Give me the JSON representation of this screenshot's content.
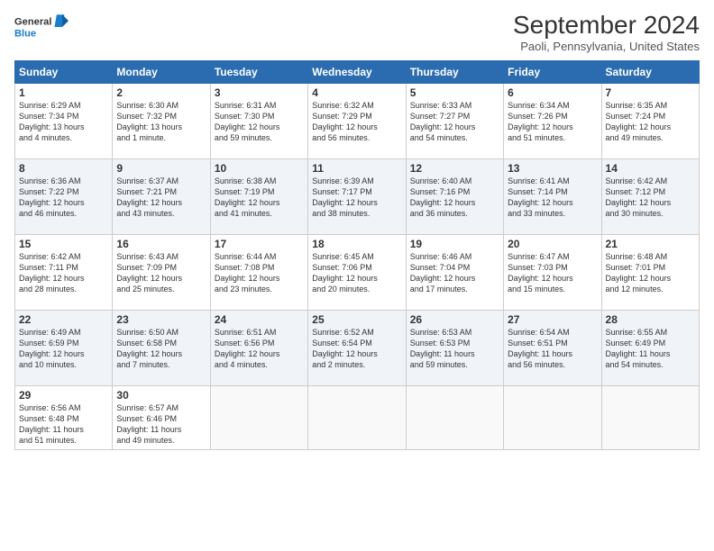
{
  "logo": {
    "line1": "General",
    "line2": "Blue"
  },
  "title": "September 2024",
  "location": "Paoli, Pennsylvania, United States",
  "days_header": [
    "Sunday",
    "Monday",
    "Tuesday",
    "Wednesday",
    "Thursday",
    "Friday",
    "Saturday"
  ],
  "weeks": [
    [
      {
        "num": "1",
        "lines": [
          "Sunrise: 6:29 AM",
          "Sunset: 7:34 PM",
          "Daylight: 13 hours",
          "and 4 minutes."
        ]
      },
      {
        "num": "2",
        "lines": [
          "Sunrise: 6:30 AM",
          "Sunset: 7:32 PM",
          "Daylight: 13 hours",
          "and 1 minute."
        ]
      },
      {
        "num": "3",
        "lines": [
          "Sunrise: 6:31 AM",
          "Sunset: 7:30 PM",
          "Daylight: 12 hours",
          "and 59 minutes."
        ]
      },
      {
        "num": "4",
        "lines": [
          "Sunrise: 6:32 AM",
          "Sunset: 7:29 PM",
          "Daylight: 12 hours",
          "and 56 minutes."
        ]
      },
      {
        "num": "5",
        "lines": [
          "Sunrise: 6:33 AM",
          "Sunset: 7:27 PM",
          "Daylight: 12 hours",
          "and 54 minutes."
        ]
      },
      {
        "num": "6",
        "lines": [
          "Sunrise: 6:34 AM",
          "Sunset: 7:26 PM",
          "Daylight: 12 hours",
          "and 51 minutes."
        ]
      },
      {
        "num": "7",
        "lines": [
          "Sunrise: 6:35 AM",
          "Sunset: 7:24 PM",
          "Daylight: 12 hours",
          "and 49 minutes."
        ]
      }
    ],
    [
      {
        "num": "8",
        "lines": [
          "Sunrise: 6:36 AM",
          "Sunset: 7:22 PM",
          "Daylight: 12 hours",
          "and 46 minutes."
        ]
      },
      {
        "num": "9",
        "lines": [
          "Sunrise: 6:37 AM",
          "Sunset: 7:21 PM",
          "Daylight: 12 hours",
          "and 43 minutes."
        ]
      },
      {
        "num": "10",
        "lines": [
          "Sunrise: 6:38 AM",
          "Sunset: 7:19 PM",
          "Daylight: 12 hours",
          "and 41 minutes."
        ]
      },
      {
        "num": "11",
        "lines": [
          "Sunrise: 6:39 AM",
          "Sunset: 7:17 PM",
          "Daylight: 12 hours",
          "and 38 minutes."
        ]
      },
      {
        "num": "12",
        "lines": [
          "Sunrise: 6:40 AM",
          "Sunset: 7:16 PM",
          "Daylight: 12 hours",
          "and 36 minutes."
        ]
      },
      {
        "num": "13",
        "lines": [
          "Sunrise: 6:41 AM",
          "Sunset: 7:14 PM",
          "Daylight: 12 hours",
          "and 33 minutes."
        ]
      },
      {
        "num": "14",
        "lines": [
          "Sunrise: 6:42 AM",
          "Sunset: 7:12 PM",
          "Daylight: 12 hours",
          "and 30 minutes."
        ]
      }
    ],
    [
      {
        "num": "15",
        "lines": [
          "Sunrise: 6:42 AM",
          "Sunset: 7:11 PM",
          "Daylight: 12 hours",
          "and 28 minutes."
        ]
      },
      {
        "num": "16",
        "lines": [
          "Sunrise: 6:43 AM",
          "Sunset: 7:09 PM",
          "Daylight: 12 hours",
          "and 25 minutes."
        ]
      },
      {
        "num": "17",
        "lines": [
          "Sunrise: 6:44 AM",
          "Sunset: 7:08 PM",
          "Daylight: 12 hours",
          "and 23 minutes."
        ]
      },
      {
        "num": "18",
        "lines": [
          "Sunrise: 6:45 AM",
          "Sunset: 7:06 PM",
          "Daylight: 12 hours",
          "and 20 minutes."
        ]
      },
      {
        "num": "19",
        "lines": [
          "Sunrise: 6:46 AM",
          "Sunset: 7:04 PM",
          "Daylight: 12 hours",
          "and 17 minutes."
        ]
      },
      {
        "num": "20",
        "lines": [
          "Sunrise: 6:47 AM",
          "Sunset: 7:03 PM",
          "Daylight: 12 hours",
          "and 15 minutes."
        ]
      },
      {
        "num": "21",
        "lines": [
          "Sunrise: 6:48 AM",
          "Sunset: 7:01 PM",
          "Daylight: 12 hours",
          "and 12 minutes."
        ]
      }
    ],
    [
      {
        "num": "22",
        "lines": [
          "Sunrise: 6:49 AM",
          "Sunset: 6:59 PM",
          "Daylight: 12 hours",
          "and 10 minutes."
        ]
      },
      {
        "num": "23",
        "lines": [
          "Sunrise: 6:50 AM",
          "Sunset: 6:58 PM",
          "Daylight: 12 hours",
          "and 7 minutes."
        ]
      },
      {
        "num": "24",
        "lines": [
          "Sunrise: 6:51 AM",
          "Sunset: 6:56 PM",
          "Daylight: 12 hours",
          "and 4 minutes."
        ]
      },
      {
        "num": "25",
        "lines": [
          "Sunrise: 6:52 AM",
          "Sunset: 6:54 PM",
          "Daylight: 12 hours",
          "and 2 minutes."
        ]
      },
      {
        "num": "26",
        "lines": [
          "Sunrise: 6:53 AM",
          "Sunset: 6:53 PM",
          "Daylight: 11 hours",
          "and 59 minutes."
        ]
      },
      {
        "num": "27",
        "lines": [
          "Sunrise: 6:54 AM",
          "Sunset: 6:51 PM",
          "Daylight: 11 hours",
          "and 56 minutes."
        ]
      },
      {
        "num": "28",
        "lines": [
          "Sunrise: 6:55 AM",
          "Sunset: 6:49 PM",
          "Daylight: 11 hours",
          "and 54 minutes."
        ]
      }
    ],
    [
      {
        "num": "29",
        "lines": [
          "Sunrise: 6:56 AM",
          "Sunset: 6:48 PM",
          "Daylight: 11 hours",
          "and 51 minutes."
        ]
      },
      {
        "num": "30",
        "lines": [
          "Sunrise: 6:57 AM",
          "Sunset: 6:46 PM",
          "Daylight: 11 hours",
          "and 49 minutes."
        ]
      },
      {
        "num": "",
        "lines": []
      },
      {
        "num": "",
        "lines": []
      },
      {
        "num": "",
        "lines": []
      },
      {
        "num": "",
        "lines": []
      },
      {
        "num": "",
        "lines": []
      }
    ]
  ]
}
